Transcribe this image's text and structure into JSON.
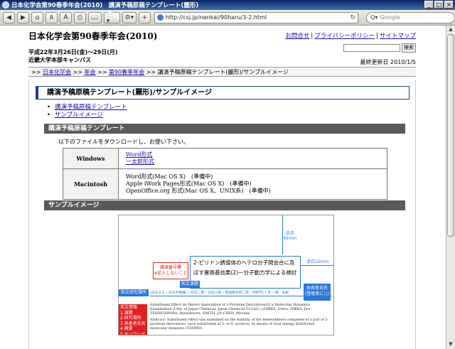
{
  "window": {
    "title": "日本化学会第90春季年会(2010)　講演予稿原稿テンプレート(麗形)",
    "buttons": [
      "_",
      "□",
      "×"
    ]
  },
  "toolbar": {
    "back": "◀",
    "forward": "▶",
    "home": "⌂",
    "text_small": "A",
    "text_large": "A",
    "print": "⎙",
    "bookmarks": "📖",
    "page_menu": "📄▾",
    "tools_menu": "⚙▾",
    "add": "+",
    "url": "http://csj.jp/nenkai/90haru/3-2.html",
    "reload": "↻",
    "search_placeholder": "Google",
    "search_prefix": "Q▾"
  },
  "site": {
    "title": "日本化学会第90春季年会(2010)",
    "date_line1": "平成22年3月26日(金)～29日(月)",
    "date_line2": "近畿大学本部キャンパス",
    "links": [
      "お問合せ",
      "プライバシーポリシー",
      "サイトマップ"
    ],
    "search_button": "検索",
    "updated": "最終更新日 2010/1/5"
  },
  "breadcrumb": {
    "prefix": ">>",
    "items": [
      "日本化学会",
      "年会",
      "第90春季年会"
    ],
    "current": "講演予稿原稿テンプレート(麗形)/サンプルイメージ"
  },
  "page": {
    "heading": "講演予稿原稿テンプレート(麗形)/サンプルイメージ",
    "toc": [
      "講演予稿原稿テンプレート",
      "サンプルイメージ"
    ],
    "section1": "講演予稿原稿テンプレート",
    "intro": "以下のファイルをダウンロードし、お使い下さい。",
    "table": [
      {
        "os": "Windows",
        "files": [
          "Word形式",
          "一太郎形式"
        ]
      },
      {
        "os": "Macintosh",
        "files": [
          "Word形式(Mac OS X)　(準備中)",
          "Apple iWork Pages形式(Mac OS X)　(準備中)",
          "OpenOffice.org 形式(Mac OS X、UNIX系)　(準備中)"
        ]
      }
    ],
    "section2": "サンプルイメージ"
  },
  "sample": {
    "top_margin": "余白\n42mm",
    "right_margin": "余白32mm",
    "number_box": "講演番号欄\n※記入しないこと",
    "title_jp": "2-ピリドン誘導体のヘテロ分子間会合に及ぼす置換基効果(2)—分子動力学による検討—",
    "jtitle_tag": "和文演題",
    "author_tag": "和文研究場所",
    "authors": "(日化大工・日化学機構) ○日化二郎・日化三郎・英語研究所二郎・SMITH, J. R.・陳　光彬",
    "author_box": "発表者氏名\n(登壇者に○)",
    "red_tag": "英文情報\n1.演題\n2.研究場所\n3.発表者氏名\n4.概要\n5.キーワード",
    "body_en": "Substituent Effect on Hetero Association of 2-Pyridone Derivatives(2) a Molecular Dynamics Examination (Univ. of Japan Chemical, Japan Chemical Co.Ltd.) ○NIKKA, Ichiro; NIKKA, Jiro; TESHIGAWARA, Ryusaburou; SMITH, J.P.;CHEN, Myoana",
    "body_abstract": "Abstract: Substituent effect was examined on the stability of the heterodimers composed of a pair of 2-pyridone derivatives, each substituted at 5- or 6- position, by means of total energy distributed molecular dynamics (TEDMD)."
  }
}
